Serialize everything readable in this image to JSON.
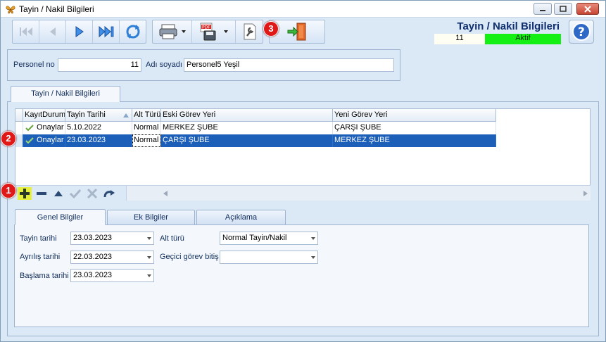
{
  "window": {
    "title": "Tayin / Nakil Bilgileri"
  },
  "header": {
    "title": "Tayin / Nakil Bilgileri",
    "record_no": "11",
    "status": "Aktif"
  },
  "badges": {
    "one": "1",
    "two": "2",
    "three": "3"
  },
  "person": {
    "no_label": "Personel no",
    "no_value": "11",
    "name_label": "Adı soyadı",
    "name_value": "Personel5 Yeşil"
  },
  "top_tab": "Tayin / Nakil Bilgileri",
  "grid": {
    "columns": [
      "KayıtDurum",
      "Tayin Tarihi",
      "Alt Türü",
      "Eski Görev Yeri",
      "Yeni Görev Yeri"
    ],
    "rows": [
      {
        "status": "Onaylar",
        "date": "5.10.2022",
        "type": "Normal",
        "old": "MERKEZ ŞUBE",
        "new": "ÇARŞI ŞUBE"
      },
      {
        "status": "Onaylar",
        "date": "23.03.2023",
        "type": "Normal",
        "old": "ÇARŞI ŞUBE",
        "new": "MERKEZ ŞUBE"
      }
    ]
  },
  "detail_tabs": [
    "Genel Bilgiler",
    "Ek Bilgiler",
    "Açıklama"
  ],
  "form": {
    "tayin_label": "Tayin tarihi",
    "tayin_value": "23.03.2023",
    "ayrilis_label": "Ayrılış tarihi",
    "ayrilis_value": "22.03.2023",
    "baslama_label": "Başlama tarihi",
    "baslama_value": "23.03.2023",
    "alt_label": "Alt türü",
    "alt_value": "Normal Tayin/Nakil",
    "gecici_label": "Geçici görev bitiş",
    "gecici_value": ""
  },
  "colors": {
    "selection": "#1c5fb8",
    "status_active": "#14f014",
    "badge": "#e01818"
  }
}
